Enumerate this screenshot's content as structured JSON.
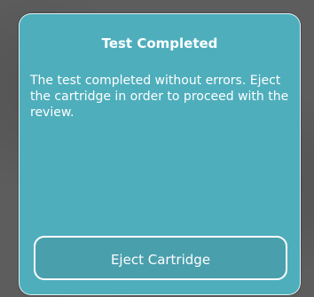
{
  "dialog": {
    "title": "Test Completed",
    "message": "The test completed without errors. Eject the cartridge in order to proceed with the review.",
    "button_label": "Eject Cartridge"
  },
  "colors": {
    "dialog_background": "#4eaebc",
    "button_background": "#4a9fac",
    "text": "#ffffff",
    "border": "#ffffff"
  }
}
